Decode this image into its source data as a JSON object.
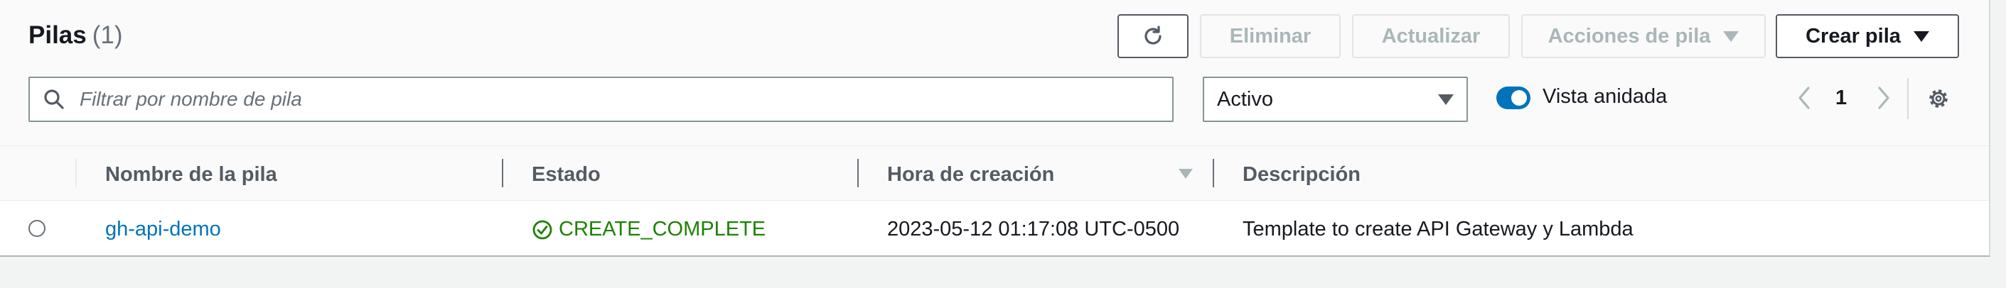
{
  "header": {
    "title": "Pilas",
    "count": "(1)"
  },
  "toolbar": {
    "delete_label": "Eliminar",
    "update_label": "Actualizar",
    "stack_actions_label": "Acciones de pila",
    "create_label": "Crear pila"
  },
  "filter": {
    "search_placeholder": "Filtrar por nombre de pila",
    "status_select_value": "Activo",
    "nested_view_label": "Vista anidada",
    "nested_view_enabled": true
  },
  "pagination": {
    "current_page": "1"
  },
  "table": {
    "columns": [
      "Nombre de la pila",
      "Estado",
      "Hora de creación",
      "Descripción"
    ],
    "rows": [
      {
        "name": "gh-api-demo",
        "status": "CREATE_COMPLETE",
        "created": "2023-05-12 01:17:08 UTC-0500",
        "description": "Template to create API Gateway y Lambda"
      }
    ]
  },
  "colors": {
    "link": "#0073bb",
    "success": "#1d8102",
    "toggle_on": "#0073bb"
  },
  "icons": [
    "refresh-icon",
    "search-icon",
    "chevron-left-icon",
    "chevron-right-icon",
    "settings-icon",
    "sort-descending-icon",
    "success-check-icon",
    "caret-down-icon"
  ]
}
